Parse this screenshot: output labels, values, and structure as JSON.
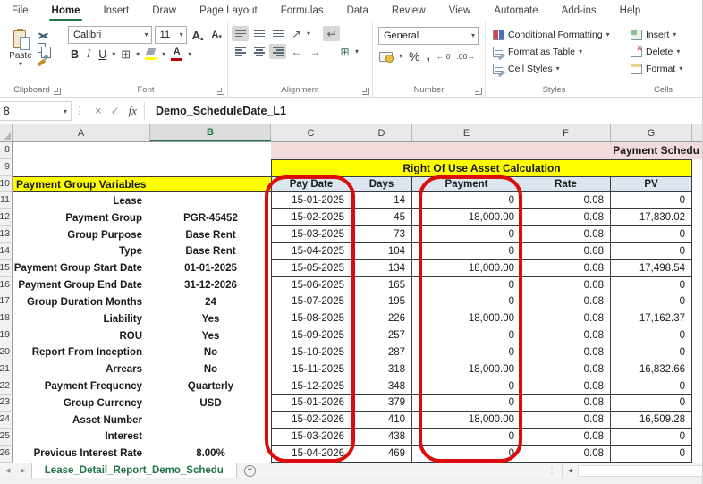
{
  "ribbon": {
    "tabs": [
      {
        "label": "File",
        "active": false
      },
      {
        "label": "Home",
        "active": true
      },
      {
        "label": "Insert",
        "active": false
      },
      {
        "label": "Draw",
        "active": false
      },
      {
        "label": "Page Layout",
        "active": false
      },
      {
        "label": "Formulas",
        "active": false
      },
      {
        "label": "Data",
        "active": false
      },
      {
        "label": "Review",
        "active": false
      },
      {
        "label": "View",
        "active": false
      },
      {
        "label": "Automate",
        "active": false
      },
      {
        "label": "Add-ins",
        "active": false
      },
      {
        "label": "Help",
        "active": false
      }
    ],
    "groups": {
      "clipboard": {
        "label": "Clipboard",
        "paste_label": "Paste"
      },
      "font": {
        "label": "Font",
        "font_name": "Calibri",
        "font_size": "11"
      },
      "alignment": {
        "label": "Alignment"
      },
      "number": {
        "label": "Number",
        "format": "General"
      },
      "styles": {
        "label": "Styles",
        "items": [
          "Conditional Formatting",
          "Format as Table",
          "Cell Styles"
        ]
      },
      "cells": {
        "label": "Cells",
        "items": [
          "Insert",
          "Delete",
          "Format"
        ]
      }
    },
    "icons": {
      "bold": "B",
      "italic": "I",
      "underline": "U",
      "grow_font": "A",
      "shrink_font": "A",
      "up_caret": "▴",
      "down_caret": "▾",
      "percent": "%",
      "comma": ",",
      "inc_decimal": "←.0",
      "dec_decimal": ".00→",
      "orientation": "↗",
      "wrap": "↩",
      "merge": "⊞",
      "borders": "⊞",
      "indent_left": "←",
      "indent_right": "→"
    }
  },
  "formula_bar": {
    "name_box": "8",
    "cancel": "×",
    "enter": "✓",
    "fx": "fx",
    "formula": "Demo_ScheduleDate_L1"
  },
  "sheet": {
    "column_headers": [
      "A",
      "B",
      "C",
      "D",
      "E",
      "F",
      "G"
    ],
    "selected_column": "B",
    "row_numbers": [
      "8",
      "9",
      "10",
      "11",
      "12",
      "13",
      "14",
      "15",
      "16",
      "17",
      "18",
      "19",
      "20",
      "21",
      "22",
      "23",
      "24",
      "25",
      "26"
    ],
    "banner": "Payment Schedu",
    "section_title": "Right Of Use Asset Calculation",
    "variables_title": "Payment Group Variables",
    "variables": [
      {
        "label": "Lease",
        "value": "",
        "bold": true
      },
      {
        "label": "Payment Group",
        "value": "PGR-45452",
        "bold": false
      },
      {
        "label": "Group Purpose",
        "value": "Base Rent",
        "bold": false
      },
      {
        "label": "Type",
        "value": "Base Rent",
        "bold": false
      },
      {
        "label": "Payment Group Start Date",
        "value": "01-01-2025",
        "bold": false
      },
      {
        "label": "Payment Group End Date",
        "value": "31-12-2026",
        "bold": false
      },
      {
        "label": "Group Duration Months",
        "value": "24",
        "bold": false
      },
      {
        "label": "Liability",
        "value": "Yes",
        "bold": false
      },
      {
        "label": "ROU",
        "value": "Yes",
        "bold": false
      },
      {
        "label": "Report From Inception",
        "value": "No",
        "bold": false
      },
      {
        "label": "Arrears",
        "value": "No",
        "bold": false
      },
      {
        "label": "Payment Frequency",
        "value": "Quarterly",
        "bold": false
      },
      {
        "label": "Group Currency",
        "value": "USD",
        "bold": false
      },
      {
        "label": "Asset Number",
        "value": "",
        "bold": false
      },
      {
        "label": "Interest",
        "value": "",
        "bold": true
      },
      {
        "label": "Previous Interest Rate",
        "value": "8.00%",
        "bold": false
      }
    ],
    "table": {
      "headers": [
        "Pay Date",
        "Days",
        "Payment",
        "Rate",
        "PV"
      ],
      "rows": [
        [
          "15-01-2025",
          "14",
          "0",
          "0.08",
          "0"
        ],
        [
          "15-02-2025",
          "45",
          "18,000.00",
          "0.08",
          "17,830.02"
        ],
        [
          "15-03-2025",
          "73",
          "0",
          "0.08",
          "0"
        ],
        [
          "15-04-2025",
          "104",
          "0",
          "0.08",
          "0"
        ],
        [
          "15-05-2025",
          "134",
          "18,000.00",
          "0.08",
          "17,498.54"
        ],
        [
          "15-06-2025",
          "165",
          "0",
          "0.08",
          "0"
        ],
        [
          "15-07-2025",
          "195",
          "0",
          "0.08",
          "0"
        ],
        [
          "15-08-2025",
          "226",
          "18,000.00",
          "0.08",
          "17,162.37"
        ],
        [
          "15-09-2025",
          "257",
          "0",
          "0.08",
          "0"
        ],
        [
          "15-10-2025",
          "287",
          "0",
          "0.08",
          "0"
        ],
        [
          "15-11-2025",
          "318",
          "18,000.00",
          "0.08",
          "16,832.66"
        ],
        [
          "15-12-2025",
          "348",
          "0",
          "0.08",
          "0"
        ],
        [
          "15-01-2026",
          "379",
          "0",
          "0.08",
          "0"
        ],
        [
          "15-02-2026",
          "410",
          "18,000.00",
          "0.08",
          "16,509.28"
        ],
        [
          "15-03-2026",
          "438",
          "0",
          "0.08",
          "0"
        ],
        [
          "15-04-2026",
          "469",
          "0",
          "0.08",
          "0"
        ]
      ]
    }
  },
  "sheet_bar": {
    "active_tab": "Lease_Detail_Report_Demo_Schedu",
    "add_sheet": "+"
  },
  "colors": {
    "accent_green": "#217346",
    "highlight_yellow": "#ffff00",
    "banner_pink": "#f2dcdb",
    "header_blue": "#dce6f1",
    "annotation_red": "#dd0c0c"
  }
}
